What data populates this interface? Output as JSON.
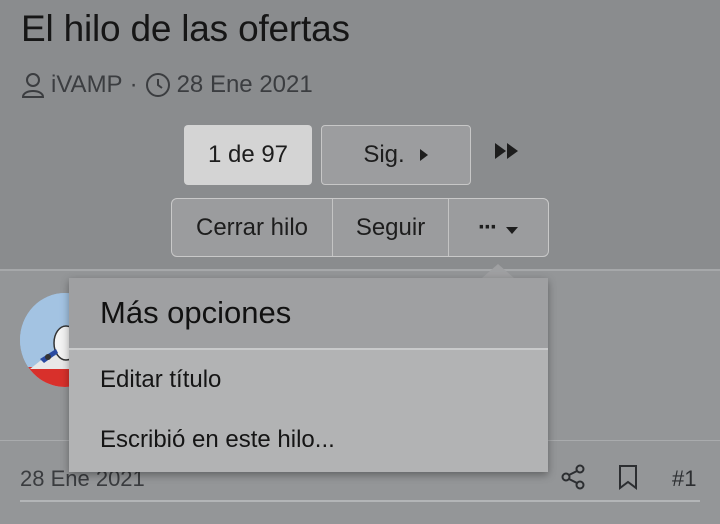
{
  "thread": {
    "title": "El hilo de las ofertas",
    "author": "iVAMP",
    "separator": "·",
    "date": "28 Ene 2021"
  },
  "pagination": {
    "current": "1 de 97",
    "next_label": "Sig."
  },
  "actions": {
    "close_label": "Cerrar hilo",
    "follow_label": "Seguir",
    "more_label": "···"
  },
  "menu": {
    "header": "Más opciones",
    "items": [
      {
        "label": "Editar título"
      },
      {
        "label": "Escribió en este hilo..."
      }
    ]
  },
  "post": {
    "date": "28 Ene 2021",
    "number": "#1"
  },
  "icons": [
    "user-icon",
    "clock-icon",
    "caret-right-icon",
    "double-chevron-right-icon",
    "caret-down-icon",
    "share-icon",
    "bookmark-icon"
  ]
}
